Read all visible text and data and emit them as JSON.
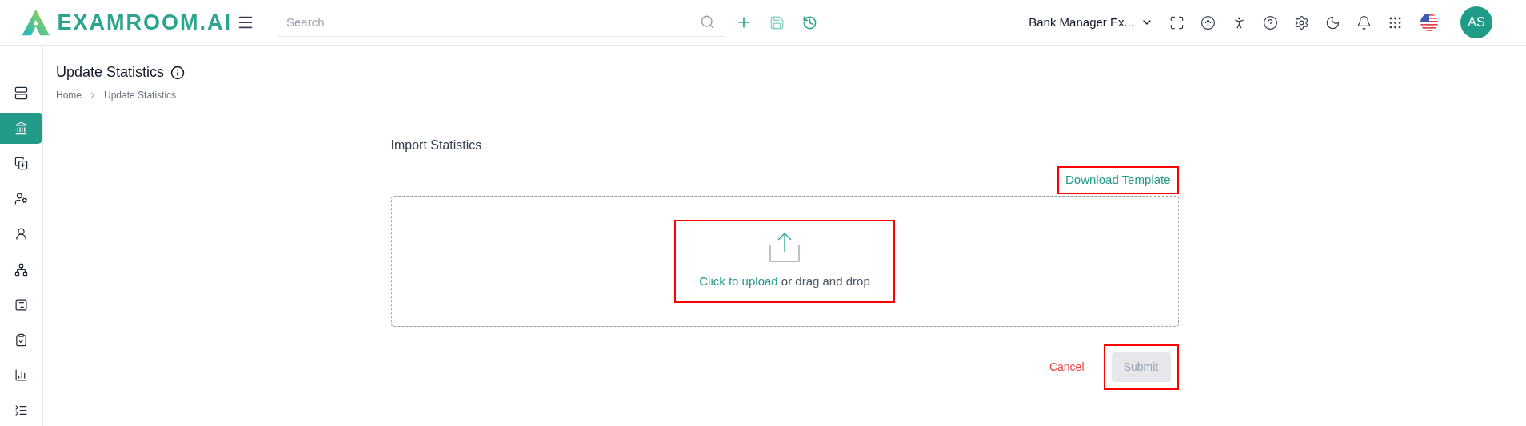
{
  "header": {
    "logo_text": "EXAMROOM.AI",
    "search": {
      "placeholder": "Search"
    },
    "role_selector": {
      "label": "Bank Manager Ex..."
    },
    "avatar": {
      "initials": "AS"
    }
  },
  "sidebar": {
    "items": [
      {
        "kind": "server",
        "selected": false
      },
      {
        "kind": "bank",
        "selected": true
      },
      {
        "kind": "add",
        "selected": false
      },
      {
        "kind": "user-gear",
        "selected": false
      },
      {
        "kind": "user",
        "selected": false
      },
      {
        "kind": "hierarchy",
        "selected": false
      },
      {
        "kind": "form",
        "selected": false
      },
      {
        "kind": "clipboard",
        "selected": false
      },
      {
        "kind": "chart",
        "selected": false
      },
      {
        "kind": "collapse",
        "selected": false
      }
    ]
  },
  "page": {
    "title": "Update Statistics",
    "breadcrumb": [
      "Home",
      "Update Statistics"
    ]
  },
  "import": {
    "heading": "Import Statistics",
    "download_link": {
      "label": "Download Template",
      "highlighted": true
    },
    "dropzone": {
      "link": "Click to upload",
      "text": " or drag and drop",
      "highlighted": true
    },
    "cancel": "Cancel",
    "submit": {
      "label": "Submit",
      "disabled": true,
      "highlighted": true
    }
  }
}
